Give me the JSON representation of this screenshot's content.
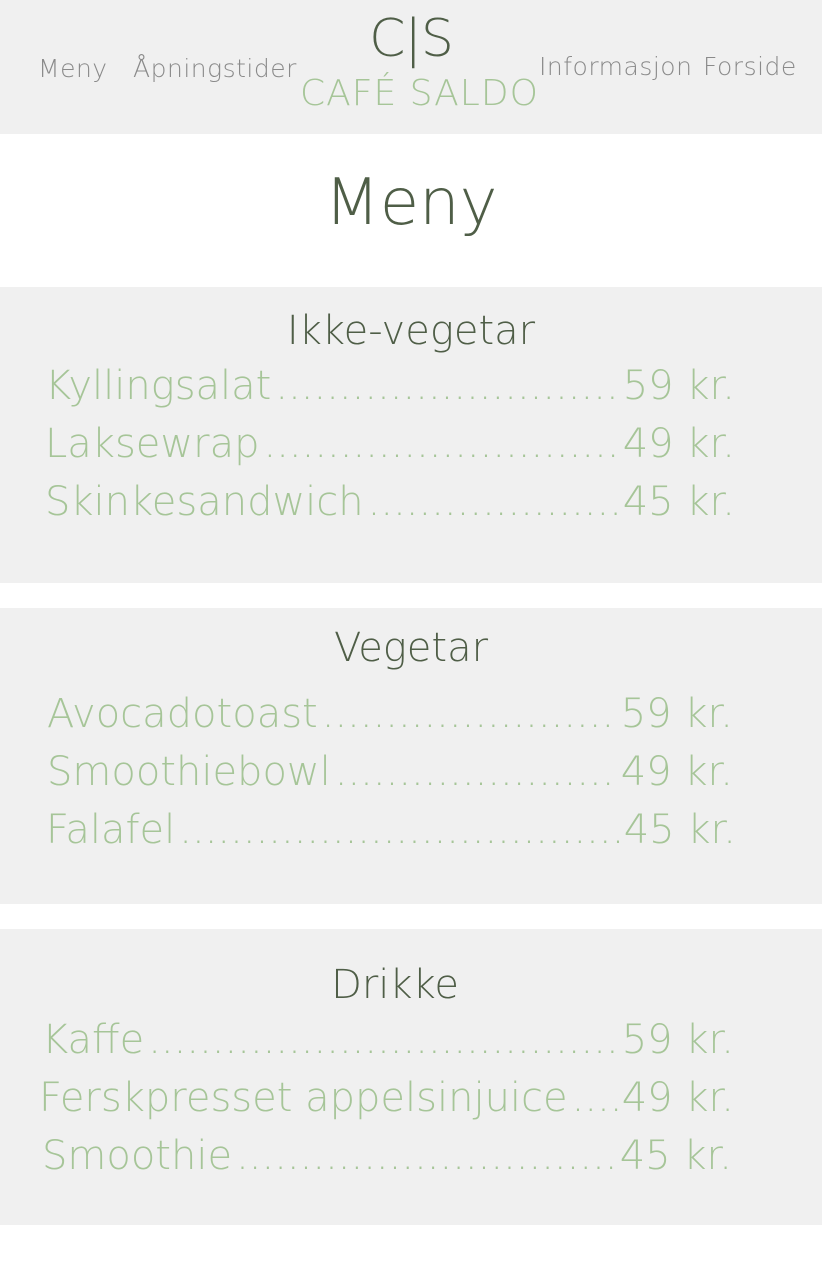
{
  "header": {
    "nav_left": [
      "Meny",
      "Åpningstider"
    ],
    "logo_mark": "C|S",
    "logo_text": "CAFÉ SALDO",
    "nav_right": [
      "Informasjon",
      "Forside"
    ]
  },
  "page": {
    "title": "Meny"
  },
  "sections": [
    {
      "heading": "Ikke-vegetar",
      "items": [
        {
          "name": "Kyllingsalat",
          "price": "59 kr."
        },
        {
          "name": "Laksewrap",
          "price": "49 kr."
        },
        {
          "name": "Skinkesandwich",
          "price": "45 kr."
        }
      ]
    },
    {
      "heading": "Vegetar",
      "items": [
        {
          "name": "Avocadotoast",
          "price": "59 kr."
        },
        {
          "name": "Smoothiebowl",
          "price": "49 kr."
        },
        {
          "name": "Falafel",
          "price": "45 kr."
        }
      ]
    },
    {
      "heading": "Drikke",
      "items": [
        {
          "name": "Kaffe",
          "price": "59 kr."
        },
        {
          "name": "Ferskpresset appelsinjuice",
          "price": "49 kr."
        },
        {
          "name": "Smoothie",
          "price": "45 kr."
        }
      ]
    }
  ],
  "colors": {
    "dark_green": "#4f5e47",
    "light_green": "#a6c598",
    "panel_gray": "#f0f0f0",
    "nav_gray": "#8a8a8a"
  }
}
